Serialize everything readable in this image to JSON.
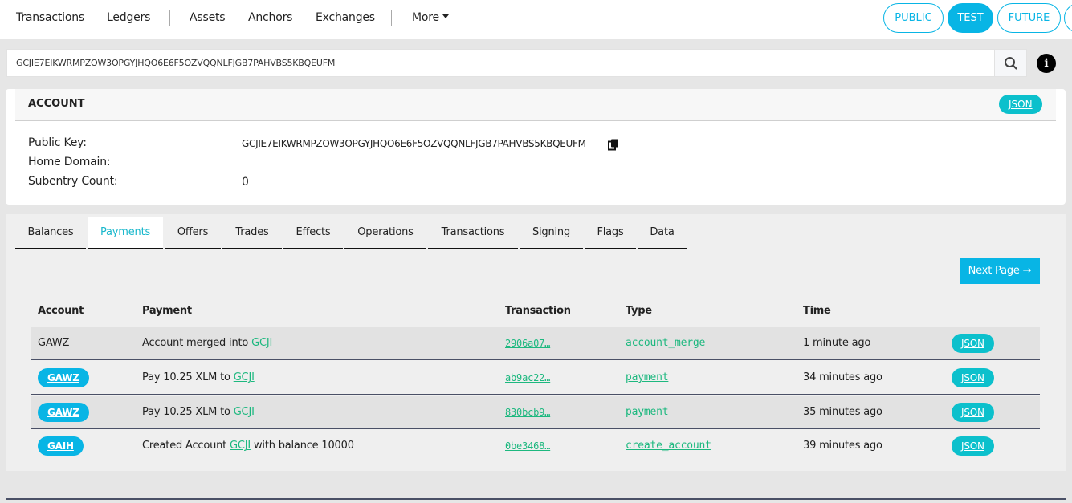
{
  "nav": {
    "links": [
      "Transactions",
      "Ledgers",
      "Assets",
      "Anchors",
      "Exchanges"
    ],
    "more_label": "More",
    "networks": [
      {
        "label": "PUBLIC",
        "active": false
      },
      {
        "label": "TEST",
        "active": true
      },
      {
        "label": "FUTURE",
        "active": false
      }
    ]
  },
  "search": {
    "value": "GCJIE7EIKWRMPZOW3OPGYJHQO6E6F5OZVQQNLFJGB7PAHVBS5KBQEUFM",
    "search_icon": "search-icon",
    "info_icon": "info-icon",
    "info_glyph": "i"
  },
  "account": {
    "title": "ACCOUNT",
    "json_label": "JSON",
    "fields": [
      {
        "label": "Public Key:",
        "value": "GCJIE7EIKWRMPZOW3OPGYJHQO6E6F5OZVQQNLFJGB7PAHVBS5KBQEUFM"
      },
      {
        "label": "Home Domain:",
        "value": ""
      },
      {
        "label": "Subentry Count:",
        "value": "0"
      }
    ],
    "copy_icon": "copy-icon"
  },
  "tabs": {
    "items": [
      "Balances",
      "Payments",
      "Offers",
      "Trades",
      "Effects",
      "Operations",
      "Transactions",
      "Signing",
      "Flags",
      "Data"
    ],
    "active": "Payments"
  },
  "payments": {
    "next_page_label": "Next Page →",
    "columns": [
      "Account",
      "Payment",
      "Transaction",
      "Type",
      "Time"
    ],
    "rows": [
      {
        "account": "GAWZ",
        "account_is_link": false,
        "payment_prefix": "Account merged into ",
        "payment_link": "GCJI",
        "payment_suffix": "",
        "transaction": "2906a07…",
        "type": "account_merge",
        "time": "1 minute ago",
        "json": "JSON"
      },
      {
        "account": "GAWZ",
        "account_is_link": true,
        "payment_prefix": "Pay 10.25 XLM to ",
        "payment_link": "GCJI",
        "payment_suffix": "",
        "transaction": "ab9ac22…",
        "type": "payment",
        "time": "34 minutes ago",
        "json": "JSON"
      },
      {
        "account": "GAWZ",
        "account_is_link": true,
        "payment_prefix": "Pay 10.25 XLM to ",
        "payment_link": "GCJI",
        "payment_suffix": "",
        "transaction": "830bcb9…",
        "type": "payment",
        "time": "35 minutes ago",
        "json": "JSON"
      },
      {
        "account": "GAIH",
        "account_is_link": true,
        "payment_prefix": "Created Account ",
        "payment_link": "GCJI",
        "payment_suffix": " with balance 10000",
        "transaction": "0be3468…",
        "type": "create_account",
        "time": "39 minutes ago",
        "json": "JSON"
      }
    ]
  },
  "colors": {
    "accent": "#08b5e5",
    "json_pill": "#0cc0cc",
    "link": "#1db87f",
    "active_tab_text": "#1ab8cc"
  }
}
